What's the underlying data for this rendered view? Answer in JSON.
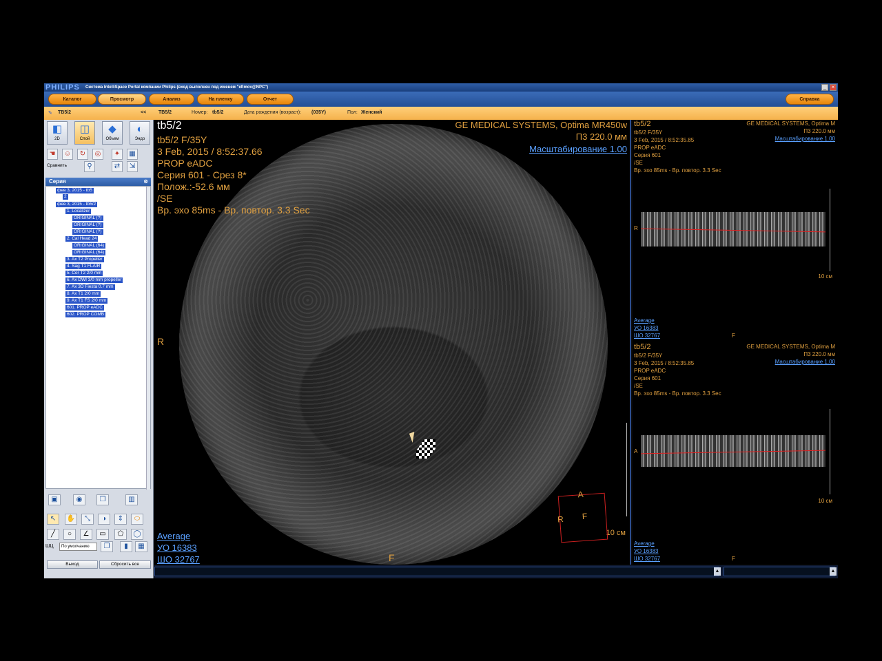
{
  "app": {
    "logo": "PHILIPS",
    "title": "Система IntelliSpace Portal компании Philips (вход выполнен под именем \"efimov@NPC\")",
    "window_buttons": [
      "_",
      "×"
    ]
  },
  "nav": {
    "items": [
      {
        "label": "Каталог"
      },
      {
        "label": "Просмотр"
      },
      {
        "label": "Анализ"
      },
      {
        "label": "На пленку"
      },
      {
        "label": "Отчет"
      }
    ],
    "help_label": "Справка"
  },
  "infobar": {
    "patient": "TB5/2",
    "collapse": "<<",
    "name": "TB5/2",
    "number_label": "Номер:",
    "number": "tb5/2",
    "dob_label": "Дата рождения (возраст):",
    "dob": "(035Y)",
    "sex_label": "Пол:",
    "sex": "Женский"
  },
  "leftpanel": {
    "tools": [
      {
        "label": "2D",
        "icon": "cube-2d-icon"
      },
      {
        "label": "Слой",
        "icon": "slab-icon"
      },
      {
        "label": "Объем",
        "icon": "volume-icon"
      },
      {
        "label": "Эндо",
        "icon": "endo-icon"
      }
    ],
    "compare_label": "Сравнить",
    "series_header": "Серия",
    "tree": [
      "фев 3, 2015 - tb5",
      "2",
      "фев 3, 2015 - tb5/2",
      "1. Localizer",
      "ORIGINAL (?)",
      "ORIGINAL (?)",
      "ORIGINAL (?)",
      "2. Cal Head 24",
      "ORIGINAL (64)",
      "ORIGINAL (64)",
      "3. Ax T2 Propeller",
      "4. Sag T1 FLAIR",
      "5. Cor T2 2/0 mm",
      "6. Ax DWI 3/0 mm propeller",
      "7. Ax 3D Fiesta 0.7 mm",
      "8. Ax T1 2/0 mm",
      "9. Ax T1 FS 2/0 mm",
      "601. PROP eADC",
      "602. PROP COMB"
    ],
    "ww_label": "ШЦ",
    "ww_value": "По умолчанию",
    "exit_label": "Выход",
    "reset_label": "Сбросить все"
  },
  "viewer": {
    "patient_id": "tb5/2",
    "patient_info": "tb5/2 F/35Y",
    "datetime": "3 Feb, 2015 / 8:52:37.66",
    "sequence": "PROP eADC",
    "series": "Серия 601 - Срез 8*",
    "position": "Полож.:-52.6 мм",
    "se": "/SE",
    "echo": "Вр. эхо  85ms - Вр. повтор. 3.3 Sec",
    "manufacturer": "GE MEDICAL SYSTEMS, Optima MR450w",
    "fov": "П3 220.0 мм",
    "zoom": "Масштабирование 1.00",
    "left_marker": "R",
    "bottom_marker": "F",
    "scale": "10 см",
    "average": "Average",
    "wl": "УО  16383",
    "ww": "ШО 32767",
    "orient": {
      "top": "A",
      "left": "R",
      "center": "F"
    }
  },
  "right_top": {
    "patient_id": "tb5/2",
    "patient_info": "tb5/2 F/35Y",
    "datetime": "3 Feb, 2015 / 8:52:35.85",
    "sequence": "PROP eADC",
    "series": "Серия 601",
    "se": "/SE",
    "echo": "Вр. эхо  85ms - Вр. повтор. 3.3 Sec",
    "manufacturer": "GE MEDICAL SYSTEMS, Optima M",
    "fov": "П3 220.0 мм",
    "zoom": "Масштабирование 1.00",
    "marker": "R",
    "scale": "10 см",
    "average": "Average",
    "wl": "УО  16383",
    "ww": "ШО 32767",
    "bottom_marker": "F"
  },
  "right_bottom": {
    "patient_id": "tb5/2",
    "patient_info": "tb5/2 F/35Y",
    "datetime": "3 Feb, 2015 / 8:52:35.85",
    "sequence": "PROP eADC",
    "series": "Серия 601",
    "se": "/SE",
    "echo": "Вр. эхо  85ms - Вр. повтор. 3.3 Sec",
    "manufacturer": "GE MEDICAL SYSTEMS, Optima M",
    "fov": "П3 220.0 мм",
    "zoom": "Масштабирование 1.00",
    "marker": "A",
    "scale": "10 см",
    "average": "Average",
    "wl": "УО  16383",
    "ww": "ШО 32767",
    "bottom_marker": "F"
  },
  "statusbar": {
    "arrow": "▲"
  }
}
